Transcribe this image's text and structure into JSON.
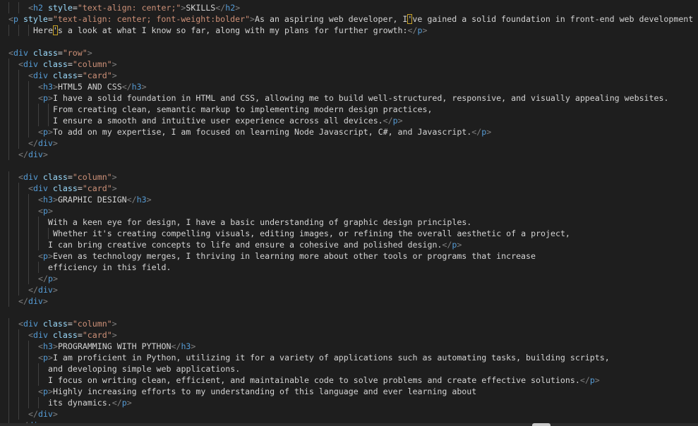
{
  "editor": {
    "language": "html",
    "theme_colors": {
      "background": "#1e1e1e",
      "tag": "#569cd6",
      "punctuation": "#808080",
      "attribute_name": "#9cdcfe",
      "attribute_value": "#ce9178",
      "text": "#d4d4d4",
      "bracket_highlight": "#c9a227"
    },
    "lines": [
      {
        "indent": 4,
        "tokens": [
          {
            "t": "punct",
            "v": "<"
          },
          {
            "t": "tag",
            "v": "h2"
          },
          {
            "t": "txt",
            "v": " "
          },
          {
            "t": "attr",
            "v": "style"
          },
          {
            "t": "txt",
            "v": "="
          },
          {
            "t": "str",
            "v": "\"text-align: center;\""
          },
          {
            "t": "punct",
            "v": ">"
          },
          {
            "t": "txt",
            "v": "SKILLS"
          },
          {
            "t": "punct",
            "v": "</"
          },
          {
            "t": "tag",
            "v": "h2"
          },
          {
            "t": "punct",
            "v": ">"
          }
        ]
      },
      {
        "indent": 0,
        "tokens": [
          {
            "t": "punct",
            "v": "<"
          },
          {
            "t": "tag",
            "v": "p"
          },
          {
            "t": "txt",
            "v": " "
          },
          {
            "t": "attr",
            "v": "style"
          },
          {
            "t": "txt",
            "v": "="
          },
          {
            "t": "str",
            "v": "\"text-align: center; font-weight:bolder\""
          },
          {
            "t": "punct",
            "v": ">"
          },
          {
            "t": "txt",
            "v": "As an aspiring web developer, I"
          },
          {
            "t": "txt",
            "v": "'",
            "hl": true
          },
          {
            "t": "txt",
            "v": "ve gained a solid foundation in front-end web development"
          }
        ]
      },
      {
        "indent": 5,
        "tokens": [
          {
            "t": "txt",
            "v": "Here"
          },
          {
            "t": "txt",
            "v": "'",
            "hl": true
          },
          {
            "t": "txt",
            "v": "s a look at what I know so far, along with my plans for further growth:"
          },
          {
            "t": "punct",
            "v": "</"
          },
          {
            "t": "tag",
            "v": "p"
          },
          {
            "t": "punct",
            "v": ">"
          }
        ]
      },
      {
        "indent": 0,
        "tokens": []
      },
      {
        "indent": 0,
        "tokens": [
          {
            "t": "punct",
            "v": "<"
          },
          {
            "t": "tag",
            "v": "div"
          },
          {
            "t": "txt",
            "v": " "
          },
          {
            "t": "attr",
            "v": "class"
          },
          {
            "t": "txt",
            "v": "="
          },
          {
            "t": "str",
            "v": "\"row\""
          },
          {
            "t": "punct",
            "v": ">"
          }
        ]
      },
      {
        "indent": 2,
        "tokens": [
          {
            "t": "punct",
            "v": "<"
          },
          {
            "t": "tag",
            "v": "div"
          },
          {
            "t": "txt",
            "v": " "
          },
          {
            "t": "attr",
            "v": "class"
          },
          {
            "t": "txt",
            "v": "="
          },
          {
            "t": "str",
            "v": "\"column\""
          },
          {
            "t": "punct",
            "v": ">"
          }
        ]
      },
      {
        "indent": 4,
        "tokens": [
          {
            "t": "punct",
            "v": "<"
          },
          {
            "t": "tag",
            "v": "div"
          },
          {
            "t": "txt",
            "v": " "
          },
          {
            "t": "attr",
            "v": "class"
          },
          {
            "t": "txt",
            "v": "="
          },
          {
            "t": "str",
            "v": "\"card\""
          },
          {
            "t": "punct",
            "v": ">"
          }
        ]
      },
      {
        "indent": 6,
        "tokens": [
          {
            "t": "punct",
            "v": "<"
          },
          {
            "t": "tag",
            "v": "h3"
          },
          {
            "t": "punct",
            "v": ">"
          },
          {
            "t": "txt",
            "v": "HTML5 AND CSS"
          },
          {
            "t": "punct",
            "v": "</"
          },
          {
            "t": "tag",
            "v": "h3"
          },
          {
            "t": "punct",
            "v": ">"
          }
        ]
      },
      {
        "indent": 6,
        "tokens": [
          {
            "t": "punct",
            "v": "<"
          },
          {
            "t": "tag",
            "v": "p"
          },
          {
            "t": "punct",
            "v": ">"
          },
          {
            "t": "txt",
            "v": "I have a solid foundation in HTML and CSS, allowing me to build well-structured, responsive, and visually appealing websites."
          }
        ]
      },
      {
        "indent": 9,
        "tokens": [
          {
            "t": "txt",
            "v": "From creating clean, semantic markup to implementing modern design practices,"
          }
        ]
      },
      {
        "indent": 9,
        "tokens": [
          {
            "t": "txt",
            "v": "I ensure a smooth and intuitive user experience across all devices."
          },
          {
            "t": "punct",
            "v": "</"
          },
          {
            "t": "tag",
            "v": "p"
          },
          {
            "t": "punct",
            "v": ">"
          }
        ]
      },
      {
        "indent": 6,
        "tokens": [
          {
            "t": "punct",
            "v": "<"
          },
          {
            "t": "tag",
            "v": "p"
          },
          {
            "t": "punct",
            "v": ">"
          },
          {
            "t": "txt",
            "v": "To add on my expertise, I am focused on learning Node Javascript, C#, and Javascript."
          },
          {
            "t": "punct",
            "v": "</"
          },
          {
            "t": "tag",
            "v": "p"
          },
          {
            "t": "punct",
            "v": ">"
          }
        ]
      },
      {
        "indent": 4,
        "tokens": [
          {
            "t": "punct",
            "v": "</"
          },
          {
            "t": "tag",
            "v": "div"
          },
          {
            "t": "punct",
            "v": ">"
          }
        ]
      },
      {
        "indent": 2,
        "tokens": [
          {
            "t": "punct",
            "v": "</"
          },
          {
            "t": "tag",
            "v": "div"
          },
          {
            "t": "punct",
            "v": ">"
          }
        ]
      },
      {
        "indent": 0,
        "tokens": []
      },
      {
        "indent": 2,
        "tokens": [
          {
            "t": "punct",
            "v": "<"
          },
          {
            "t": "tag",
            "v": "div"
          },
          {
            "t": "txt",
            "v": " "
          },
          {
            "t": "attr",
            "v": "class"
          },
          {
            "t": "txt",
            "v": "="
          },
          {
            "t": "str",
            "v": "\"column\""
          },
          {
            "t": "punct",
            "v": ">"
          }
        ]
      },
      {
        "indent": 4,
        "tokens": [
          {
            "t": "punct",
            "v": "<"
          },
          {
            "t": "tag",
            "v": "div"
          },
          {
            "t": "txt",
            "v": " "
          },
          {
            "t": "attr",
            "v": "class"
          },
          {
            "t": "txt",
            "v": "="
          },
          {
            "t": "str",
            "v": "\"card\""
          },
          {
            "t": "punct",
            "v": ">"
          }
        ]
      },
      {
        "indent": 6,
        "tokens": [
          {
            "t": "punct",
            "v": "<"
          },
          {
            "t": "tag",
            "v": "h3"
          },
          {
            "t": "punct",
            "v": ">"
          },
          {
            "t": "txt",
            "v": "GRAPHIC DESIGN"
          },
          {
            "t": "punct",
            "v": "</"
          },
          {
            "t": "tag",
            "v": "h3"
          },
          {
            "t": "punct",
            "v": ">"
          }
        ]
      },
      {
        "indent": 6,
        "tokens": [
          {
            "t": "punct",
            "v": "<"
          },
          {
            "t": "tag",
            "v": "p"
          },
          {
            "t": "punct",
            "v": ">"
          }
        ]
      },
      {
        "indent": 8,
        "tokens": [
          {
            "t": "txt",
            "v": "With a keen eye for design, I have a basic understanding of graphic design principles."
          }
        ]
      },
      {
        "indent": 9,
        "tokens": [
          {
            "t": "txt",
            "v": "Whether it's creating compelling visuals, editing images, or refining the overall aesthetic of a project,"
          }
        ]
      },
      {
        "indent": 8,
        "tokens": [
          {
            "t": "txt",
            "v": "I can bring creative concepts to life and ensure a cohesive and polished design."
          },
          {
            "t": "punct",
            "v": "</"
          },
          {
            "t": "tag",
            "v": "p"
          },
          {
            "t": "punct",
            "v": ">"
          }
        ]
      },
      {
        "indent": 6,
        "tokens": [
          {
            "t": "punct",
            "v": "<"
          },
          {
            "t": "tag",
            "v": "p"
          },
          {
            "t": "punct",
            "v": ">"
          },
          {
            "t": "txt",
            "v": "Even as technology merges, I thriving in learning more about other tools or programs that increase"
          }
        ]
      },
      {
        "indent": 8,
        "tokens": [
          {
            "t": "txt",
            "v": "efficiency in this field."
          }
        ]
      },
      {
        "indent": 6,
        "tokens": [
          {
            "t": "punct",
            "v": "</"
          },
          {
            "t": "tag",
            "v": "p"
          },
          {
            "t": "punct",
            "v": ">"
          }
        ]
      },
      {
        "indent": 4,
        "tokens": [
          {
            "t": "punct",
            "v": "</"
          },
          {
            "t": "tag",
            "v": "div"
          },
          {
            "t": "punct",
            "v": ">"
          }
        ]
      },
      {
        "indent": 2,
        "tokens": [
          {
            "t": "punct",
            "v": "</"
          },
          {
            "t": "tag",
            "v": "div"
          },
          {
            "t": "punct",
            "v": ">"
          }
        ]
      },
      {
        "indent": 0,
        "tokens": []
      },
      {
        "indent": 2,
        "tokens": [
          {
            "t": "punct",
            "v": "<"
          },
          {
            "t": "tag",
            "v": "div"
          },
          {
            "t": "txt",
            "v": " "
          },
          {
            "t": "attr",
            "v": "class"
          },
          {
            "t": "txt",
            "v": "="
          },
          {
            "t": "str",
            "v": "\"column\""
          },
          {
            "t": "punct",
            "v": ">"
          }
        ]
      },
      {
        "indent": 4,
        "tokens": [
          {
            "t": "punct",
            "v": "<"
          },
          {
            "t": "tag",
            "v": "div"
          },
          {
            "t": "txt",
            "v": " "
          },
          {
            "t": "attr",
            "v": "class"
          },
          {
            "t": "txt",
            "v": "="
          },
          {
            "t": "str",
            "v": "\"card\""
          },
          {
            "t": "punct",
            "v": ">"
          }
        ]
      },
      {
        "indent": 6,
        "tokens": [
          {
            "t": "punct",
            "v": "<"
          },
          {
            "t": "tag",
            "v": "h3"
          },
          {
            "t": "punct",
            "v": ">"
          },
          {
            "t": "txt",
            "v": "PROGRAMMING WITH PYTHON"
          },
          {
            "t": "punct",
            "v": "</"
          },
          {
            "t": "tag",
            "v": "h3"
          },
          {
            "t": "punct",
            "v": ">"
          }
        ]
      },
      {
        "indent": 6,
        "tokens": [
          {
            "t": "punct",
            "v": "<"
          },
          {
            "t": "tag",
            "v": "p"
          },
          {
            "t": "punct",
            "v": ">"
          },
          {
            "t": "txt",
            "v": "I am proficient in Python, utilizing it for a variety of applications such as automating tasks, building scripts,"
          }
        ]
      },
      {
        "indent": 8,
        "tokens": [
          {
            "t": "txt",
            "v": "and developing simple web applications."
          }
        ]
      },
      {
        "indent": 8,
        "tokens": [
          {
            "t": "txt",
            "v": "I focus on writing clean, efficient, and maintainable code to solve problems and create effective solutions."
          },
          {
            "t": "punct",
            "v": "</"
          },
          {
            "t": "tag",
            "v": "p"
          },
          {
            "t": "punct",
            "v": ">"
          }
        ]
      },
      {
        "indent": 6,
        "tokens": [
          {
            "t": "punct",
            "v": "<"
          },
          {
            "t": "tag",
            "v": "p"
          },
          {
            "t": "punct",
            "v": ">"
          },
          {
            "t": "txt",
            "v": "Highly increasing efforts to my understanding of this language and ever learning about"
          }
        ]
      },
      {
        "indent": 8,
        "tokens": [
          {
            "t": "txt",
            "v": "its dynamics."
          },
          {
            "t": "punct",
            "v": "</"
          },
          {
            "t": "tag",
            "v": "p"
          },
          {
            "t": "punct",
            "v": ">"
          }
        ]
      },
      {
        "indent": 4,
        "tokens": [
          {
            "t": "punct",
            "v": "</"
          },
          {
            "t": "tag",
            "v": "div"
          },
          {
            "t": "punct",
            "v": ">"
          }
        ]
      },
      {
        "indent": 2,
        "tokens": [
          {
            "t": "punct",
            "v": "</"
          },
          {
            "t": "tag",
            "v": "div"
          },
          {
            "t": "punct",
            "v": ">"
          }
        ]
      }
    ]
  }
}
